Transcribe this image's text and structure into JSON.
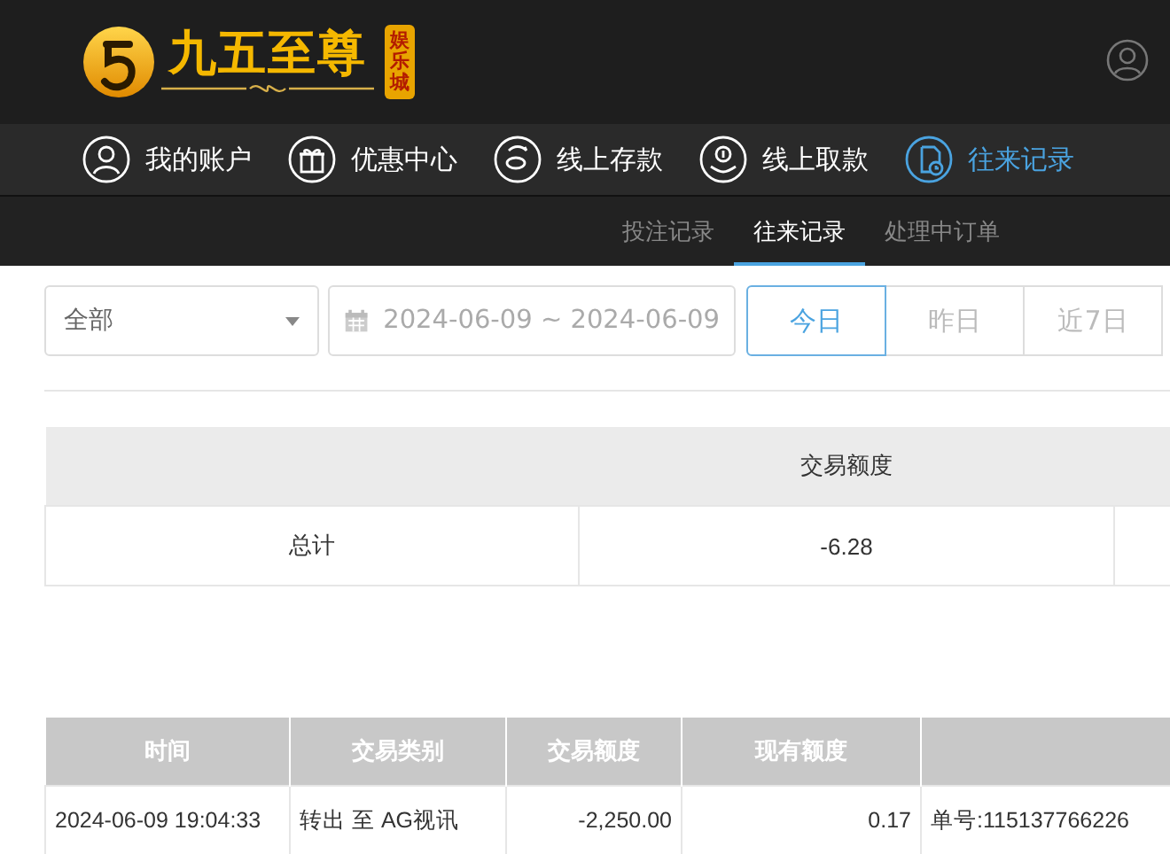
{
  "logo": {
    "name": "九五至尊",
    "badge": "娱乐城"
  },
  "nav": [
    {
      "label": "我的账户",
      "selected": false
    },
    {
      "label": "优惠中心",
      "selected": false
    },
    {
      "label": "线上存款",
      "selected": false
    },
    {
      "label": "线上取款",
      "selected": false
    },
    {
      "label": "往来记录",
      "selected": true
    }
  ],
  "subtabs": [
    {
      "label": "投注记录",
      "selected": false
    },
    {
      "label": "往来记录",
      "selected": true
    },
    {
      "label": "处理中订单",
      "selected": false
    }
  ],
  "filters": {
    "type_select": "全部",
    "date_range": "2024-06-09 ~ 2024-06-09",
    "quick_ranges": [
      {
        "label": "今日",
        "selected": true
      },
      {
        "label": "昨日",
        "selected": false
      },
      {
        "label": "近7日",
        "selected": false
      }
    ]
  },
  "summary": {
    "columns": [
      "",
      "交易额度",
      ""
    ],
    "rows": [
      [
        "总计",
        "-6.28",
        ""
      ]
    ]
  },
  "table": {
    "columns": [
      "时间",
      "交易类别",
      "交易额度",
      "现有额度",
      ""
    ],
    "rows": [
      [
        "2024-06-09 19:04:33",
        "转出 至 AG视讯",
        "-2,250.00",
        "0.17",
        "单号:115137766226"
      ]
    ]
  }
}
